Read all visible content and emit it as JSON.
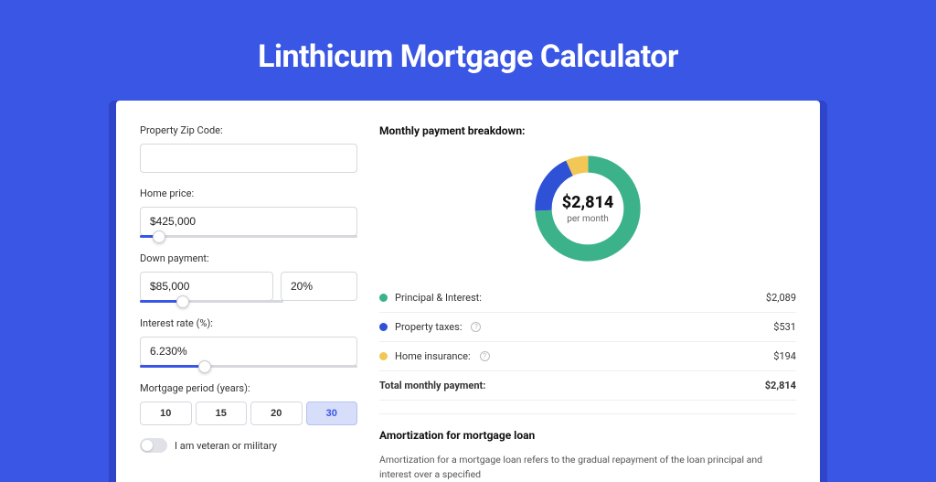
{
  "title": "Linthicum Mortgage Calculator",
  "form": {
    "zip": {
      "label": "Property Zip Code:",
      "value": ""
    },
    "price": {
      "label": "Home price:",
      "value": "$425,000",
      "slider_fill_pct": 9
    },
    "down": {
      "label": "Down payment:",
      "amount": "$85,000",
      "pct": "20%",
      "slider_fill_pct": 20
    },
    "rate": {
      "label": "Interest rate (%):",
      "value": "6.230%",
      "slider_fill_pct": 30
    },
    "period": {
      "label": "Mortgage period (years):",
      "options": [
        "10",
        "15",
        "20",
        "30"
      ],
      "selected": "30"
    },
    "veteran": {
      "label": "I am veteran or military",
      "checked": false
    }
  },
  "breakdown": {
    "heading": "Monthly payment breakdown:",
    "center_amount": "$2,814",
    "center_sub": "per month",
    "items": [
      {
        "label": "Principal & Interest:",
        "value": "$2,089",
        "color": "#3bb28a",
        "info": false
      },
      {
        "label": "Property taxes:",
        "value": "$531",
        "color": "#2f51d6",
        "info": true
      },
      {
        "label": "Home insurance:",
        "value": "$194",
        "color": "#f2c755",
        "info": true
      }
    ],
    "total": {
      "label": "Total monthly payment:",
      "value": "$2,814"
    }
  },
  "amortization": {
    "heading": "Amortization for mortgage loan",
    "text": "Amortization for a mortgage loan refers to the gradual repayment of the loan principal and interest over a specified"
  },
  "chart_data": {
    "type": "pie",
    "title": "Monthly payment breakdown",
    "series": [
      {
        "name": "Principal & Interest",
        "value": 2089,
        "color": "#3bb28a"
      },
      {
        "name": "Property taxes",
        "value": 531,
        "color": "#2f51d6"
      },
      {
        "name": "Home insurance",
        "value": 194,
        "color": "#f2c755"
      }
    ],
    "total": 2814,
    "center_label": "$2,814 per month"
  }
}
